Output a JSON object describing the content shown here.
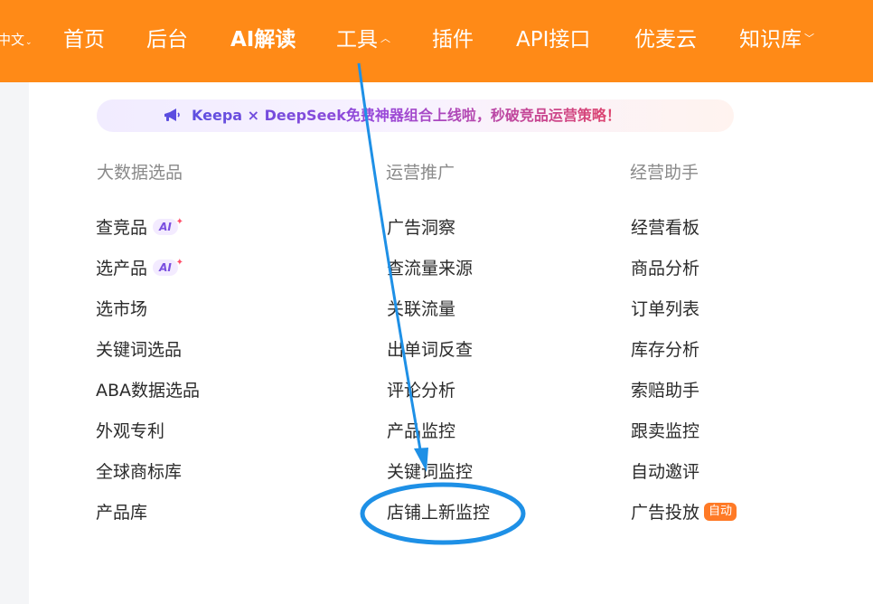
{
  "nav": {
    "language": "中文",
    "items": [
      {
        "label": "首页"
      },
      {
        "label": "后台"
      },
      {
        "label": "AI解读"
      },
      {
        "label": "工具"
      },
      {
        "label": "插件"
      },
      {
        "label": "API接口"
      },
      {
        "label": "优麦云"
      },
      {
        "label": "知识库"
      }
    ]
  },
  "banner": {
    "text": "Keepa × DeepSeek免费神器组合上线啦，秒破竞品运营策略！"
  },
  "columns": [
    {
      "title": "大数据选品",
      "items": [
        "查竞品",
        "选产品",
        "选市场",
        "关键词选品",
        "ABA数据选品",
        "外观专利",
        "全球商标库",
        "产品库"
      ]
    },
    {
      "title": "运营推广",
      "items": [
        "广告洞察",
        "查流量来源",
        "关联流量",
        "出单词反查",
        "评论分析",
        "产品监控",
        "关键词监控",
        "店铺上新监控"
      ]
    },
    {
      "title": "经营助手",
      "items": [
        "经营看板",
        "商品分析",
        "订单列表",
        "库存分析",
        "索赔助手",
        "跟卖监控",
        "自动邀评",
        "广告投放"
      ]
    }
  ],
  "badges": {
    "ai": "AI",
    "auto": "自动"
  },
  "colors": {
    "brand_orange": "#ff8a17",
    "annotation_blue": "#1e90e6"
  }
}
